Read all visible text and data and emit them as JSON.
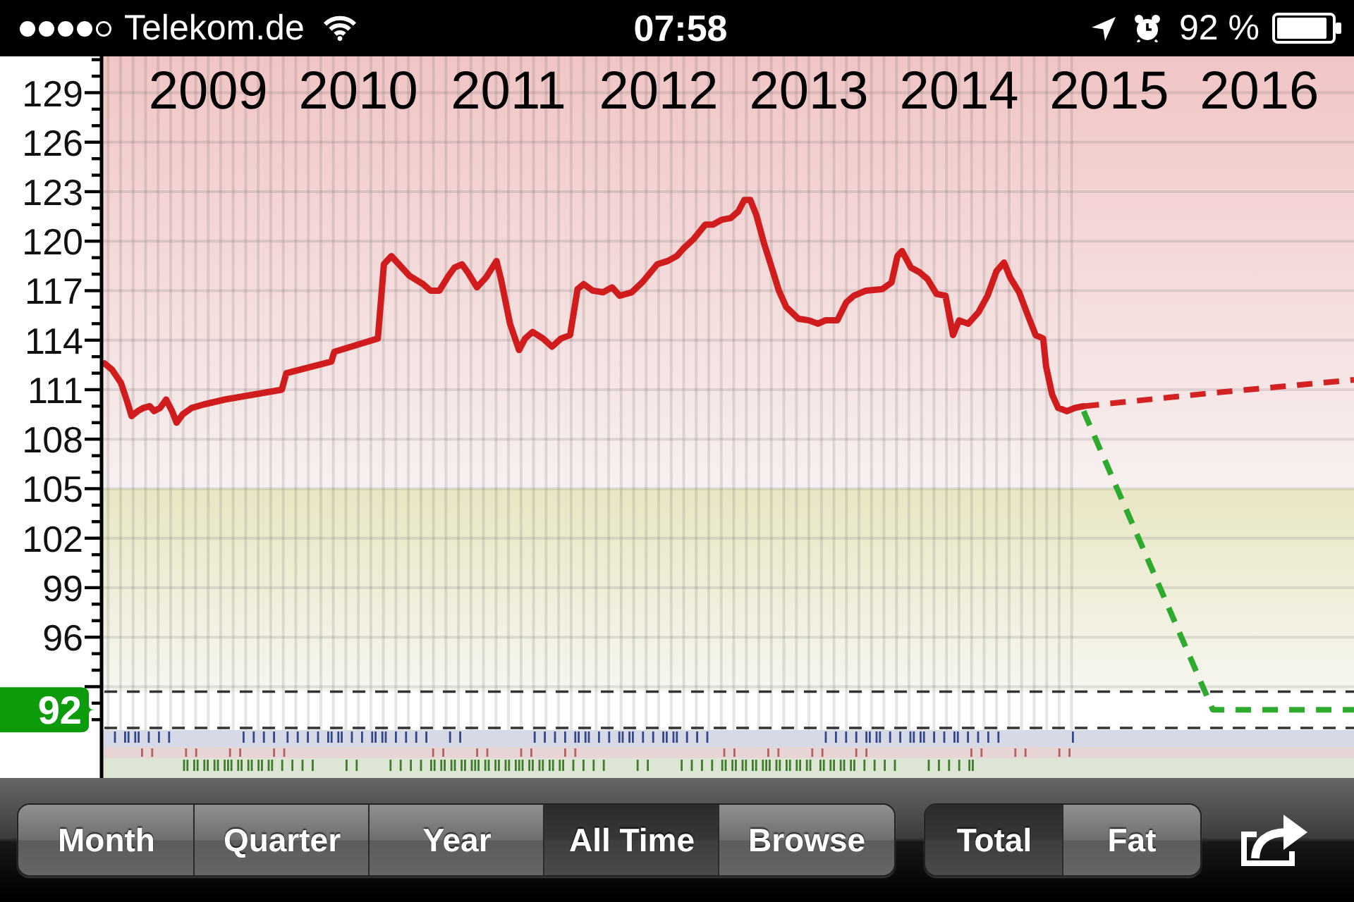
{
  "status_bar": {
    "carrier": "Telekom.de",
    "time": "07:58",
    "battery": "92 %"
  },
  "chart": {
    "chart_data": {
      "type": "line",
      "x": [
        2008.31,
        2008.36,
        2008.42,
        2008.46,
        2008.49,
        2008.53,
        2008.57,
        2008.61,
        2008.64,
        2008.68,
        2008.72,
        2008.76,
        2008.79,
        2008.83,
        2008.89,
        2008.97,
        2009.11,
        2009.3,
        2009.49,
        2009.52,
        2009.82,
        2009.84,
        2010.13,
        2010.17,
        2010.22,
        2010.34,
        2010.43,
        2010.48,
        2010.54,
        2010.6,
        2010.64,
        2010.69,
        2010.73,
        2010.79,
        2010.85,
        2010.92,
        2010.95,
        2011.01,
        2011.07,
        2011.11,
        2011.16,
        2011.23,
        2011.29,
        2011.35,
        2011.41,
        2011.46,
        2011.5,
        2011.56,
        2011.63,
        2011.69,
        2011.74,
        2011.82,
        2011.89,
        2011.99,
        2012.06,
        2012.12,
        2012.17,
        2012.23,
        2012.31,
        2012.36,
        2012.42,
        2012.48,
        2012.53,
        2012.57,
        2012.61,
        2012.65,
        2012.7,
        2012.76,
        2012.8,
        2012.85,
        2012.93,
        2013,
        2013.06,
        2013.11,
        2013.19,
        2013.25,
        2013.3,
        2013.38,
        2013.49,
        2013.55,
        2013.59,
        2013.62,
        2013.68,
        2013.74,
        2013.79,
        2013.85,
        2013.91,
        2013.96,
        2014,
        2014.06,
        2014.13,
        2014.19,
        2014.25,
        2014.3,
        2014.34,
        2014.4,
        2014.45,
        2014.51,
        2014.56,
        2014.58,
        2014.62,
        2014.66,
        2014.72,
        2014.77,
        2014.83,
        2015.69,
        2016.63
      ],
      "series": [
        {
          "color": "#d01c1c",
          "line_style": "solid",
          "values": [
            112.6,
            112.2,
            111.4,
            110.3,
            109.4,
            109.7,
            109.9,
            110.0,
            109.7,
            109.9,
            110.4,
            109.7,
            109.0,
            109.5,
            109.9,
            110.1,
            110.4,
            110.7,
            111.0,
            112.0,
            112.7,
            113.3,
            114.1,
            118.6,
            119.1,
            117.9,
            117.4,
            117.0,
            117.0,
            117.9,
            118.4,
            118.6,
            118.1,
            117.2,
            117.8,
            118.8,
            117.7,
            115.0,
            113.4,
            114.1,
            114.5,
            114.1,
            113.6,
            114.1,
            114.3,
            117.1,
            117.4,
            117.0,
            116.9,
            117.2,
            116.7,
            116.9,
            117.5,
            118.6,
            118.8,
            119.1,
            119.6,
            120.1,
            121.0,
            121.0,
            121.3,
            121.4,
            121.8,
            122.5,
            122.5,
            121.6,
            119.9,
            118.2,
            117.0,
            116.0,
            115.3,
            115.2,
            115.0,
            115.2,
            115.2,
            116.3,
            116.7,
            117.0,
            117.1,
            117.5,
            119.1,
            119.4,
            118.4,
            118.1,
            117.7,
            116.8,
            116.7,
            114.3,
            115.2,
            115.0,
            115.7,
            116.7,
            118.2,
            118.7,
            117.8,
            116.9,
            115.7,
            114.3,
            114.1,
            112.4,
            110.7,
            109.9,
            109.7,
            109.9,
            110.0,
            null,
            null
          ]
        },
        {
          "color": "#d42222",
          "line_style": "dashed",
          "values": [
            null,
            null,
            null,
            null,
            null,
            null,
            null,
            null,
            null,
            null,
            null,
            null,
            null,
            null,
            null,
            null,
            null,
            null,
            null,
            null,
            null,
            null,
            null,
            null,
            null,
            null,
            null,
            null,
            null,
            null,
            null,
            null,
            null,
            null,
            null,
            null,
            null,
            null,
            null,
            null,
            null,
            null,
            null,
            null,
            null,
            null,
            null,
            null,
            null,
            null,
            null,
            null,
            null,
            null,
            null,
            null,
            null,
            null,
            null,
            null,
            null,
            null,
            null,
            null,
            null,
            null,
            null,
            null,
            null,
            null,
            null,
            null,
            null,
            null,
            null,
            null,
            null,
            null,
            null,
            null,
            null,
            null,
            null,
            null,
            null,
            null,
            null,
            null,
            null,
            null,
            null,
            null,
            null,
            null,
            null,
            null,
            null,
            null,
            null,
            null,
            null,
            null,
            null,
            null,
            110.0,
            110.8,
            111.6
          ]
        },
        {
          "color": "#2eaa2e",
          "line_style": "dashed",
          "values": [
            null,
            null,
            null,
            null,
            null,
            null,
            null,
            null,
            null,
            null,
            null,
            null,
            null,
            null,
            null,
            null,
            null,
            null,
            null,
            null,
            null,
            null,
            null,
            null,
            null,
            null,
            null,
            null,
            null,
            null,
            null,
            null,
            null,
            null,
            null,
            null,
            null,
            null,
            null,
            null,
            null,
            null,
            null,
            null,
            null,
            null,
            null,
            null,
            null,
            null,
            null,
            null,
            null,
            null,
            null,
            null,
            null,
            null,
            null,
            null,
            null,
            null,
            null,
            null,
            null,
            null,
            null,
            null,
            null,
            null,
            null,
            null,
            null,
            null,
            null,
            null,
            null,
            null,
            null,
            null,
            null,
            null,
            null,
            null,
            null,
            null,
            null,
            null,
            null,
            null,
            null,
            null,
            null,
            null,
            null,
            null,
            null,
            null,
            null,
            null,
            null,
            null,
            null,
            null,
            109.7,
            91.6,
            91.6
          ]
        }
      ],
      "xlim": [
        2008.29,
        2016.63
      ],
      "ylim": [
        90.37,
        131.2
      ],
      "xticks": [
        2009,
        2010,
        2011,
        2012,
        2013,
        2014,
        2015,
        2016
      ],
      "yticks": [
        96,
        99,
        102,
        105,
        108,
        111,
        114,
        117,
        120,
        123,
        126,
        129
      ],
      "grid": true,
      "bands": [
        {
          "axis": "y",
          "from": 105,
          "to": 131.2,
          "color": "#f1c5c5"
        },
        {
          "axis": "y",
          "from": 92.7,
          "to": 105,
          "color": "#e8e6c3"
        }
      ],
      "ref_lines": [
        {
          "axis": "y",
          "value": 92.7
        },
        {
          "axis": "y",
          "value": 90.5
        }
      ],
      "annotations": [
        "92"
      ]
    }
  },
  "toolbar": {
    "range_tabs": [
      {
        "label": "Month",
        "selected": false
      },
      {
        "label": "Quarter",
        "selected": false
      },
      {
        "label": "Year",
        "selected": false
      },
      {
        "label": "All Time",
        "selected": true
      },
      {
        "label": "Browse",
        "selected": false
      }
    ],
    "measure_tabs": [
      {
        "label": "Total",
        "selected": true
      },
      {
        "label": "Fat",
        "selected": false
      }
    ]
  }
}
